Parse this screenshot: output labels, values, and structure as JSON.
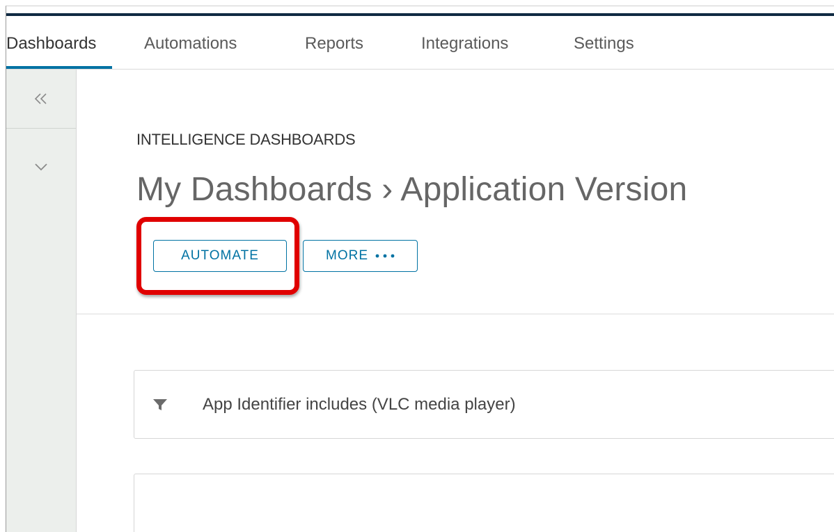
{
  "nav": {
    "tabs": [
      {
        "label": "Dashboards",
        "active": true
      },
      {
        "label": "Automations",
        "active": false
      },
      {
        "label": "Reports",
        "active": false
      },
      {
        "label": "Integrations",
        "active": false
      },
      {
        "label": "Settings",
        "active": false
      }
    ]
  },
  "sidebar": {
    "collapse_icon": "double-chevron-left-icon",
    "expand_icon": "chevron-down-icon"
  },
  "header": {
    "subtitle": "INTELLIGENCE DASHBOARDS",
    "title": "My Dashboards › Application Version"
  },
  "actions": {
    "automate_label": "AUTOMATE",
    "more_label": "MORE",
    "more_icon": "ellipsis-icon"
  },
  "filter": {
    "icon": "filter-icon",
    "text": "App Identifier includes (VLC media player)"
  },
  "colors": {
    "accent": "#0072a3",
    "highlight": "#e00000",
    "topbar": "#102a43",
    "sidebar_bg": "#ecefec"
  }
}
